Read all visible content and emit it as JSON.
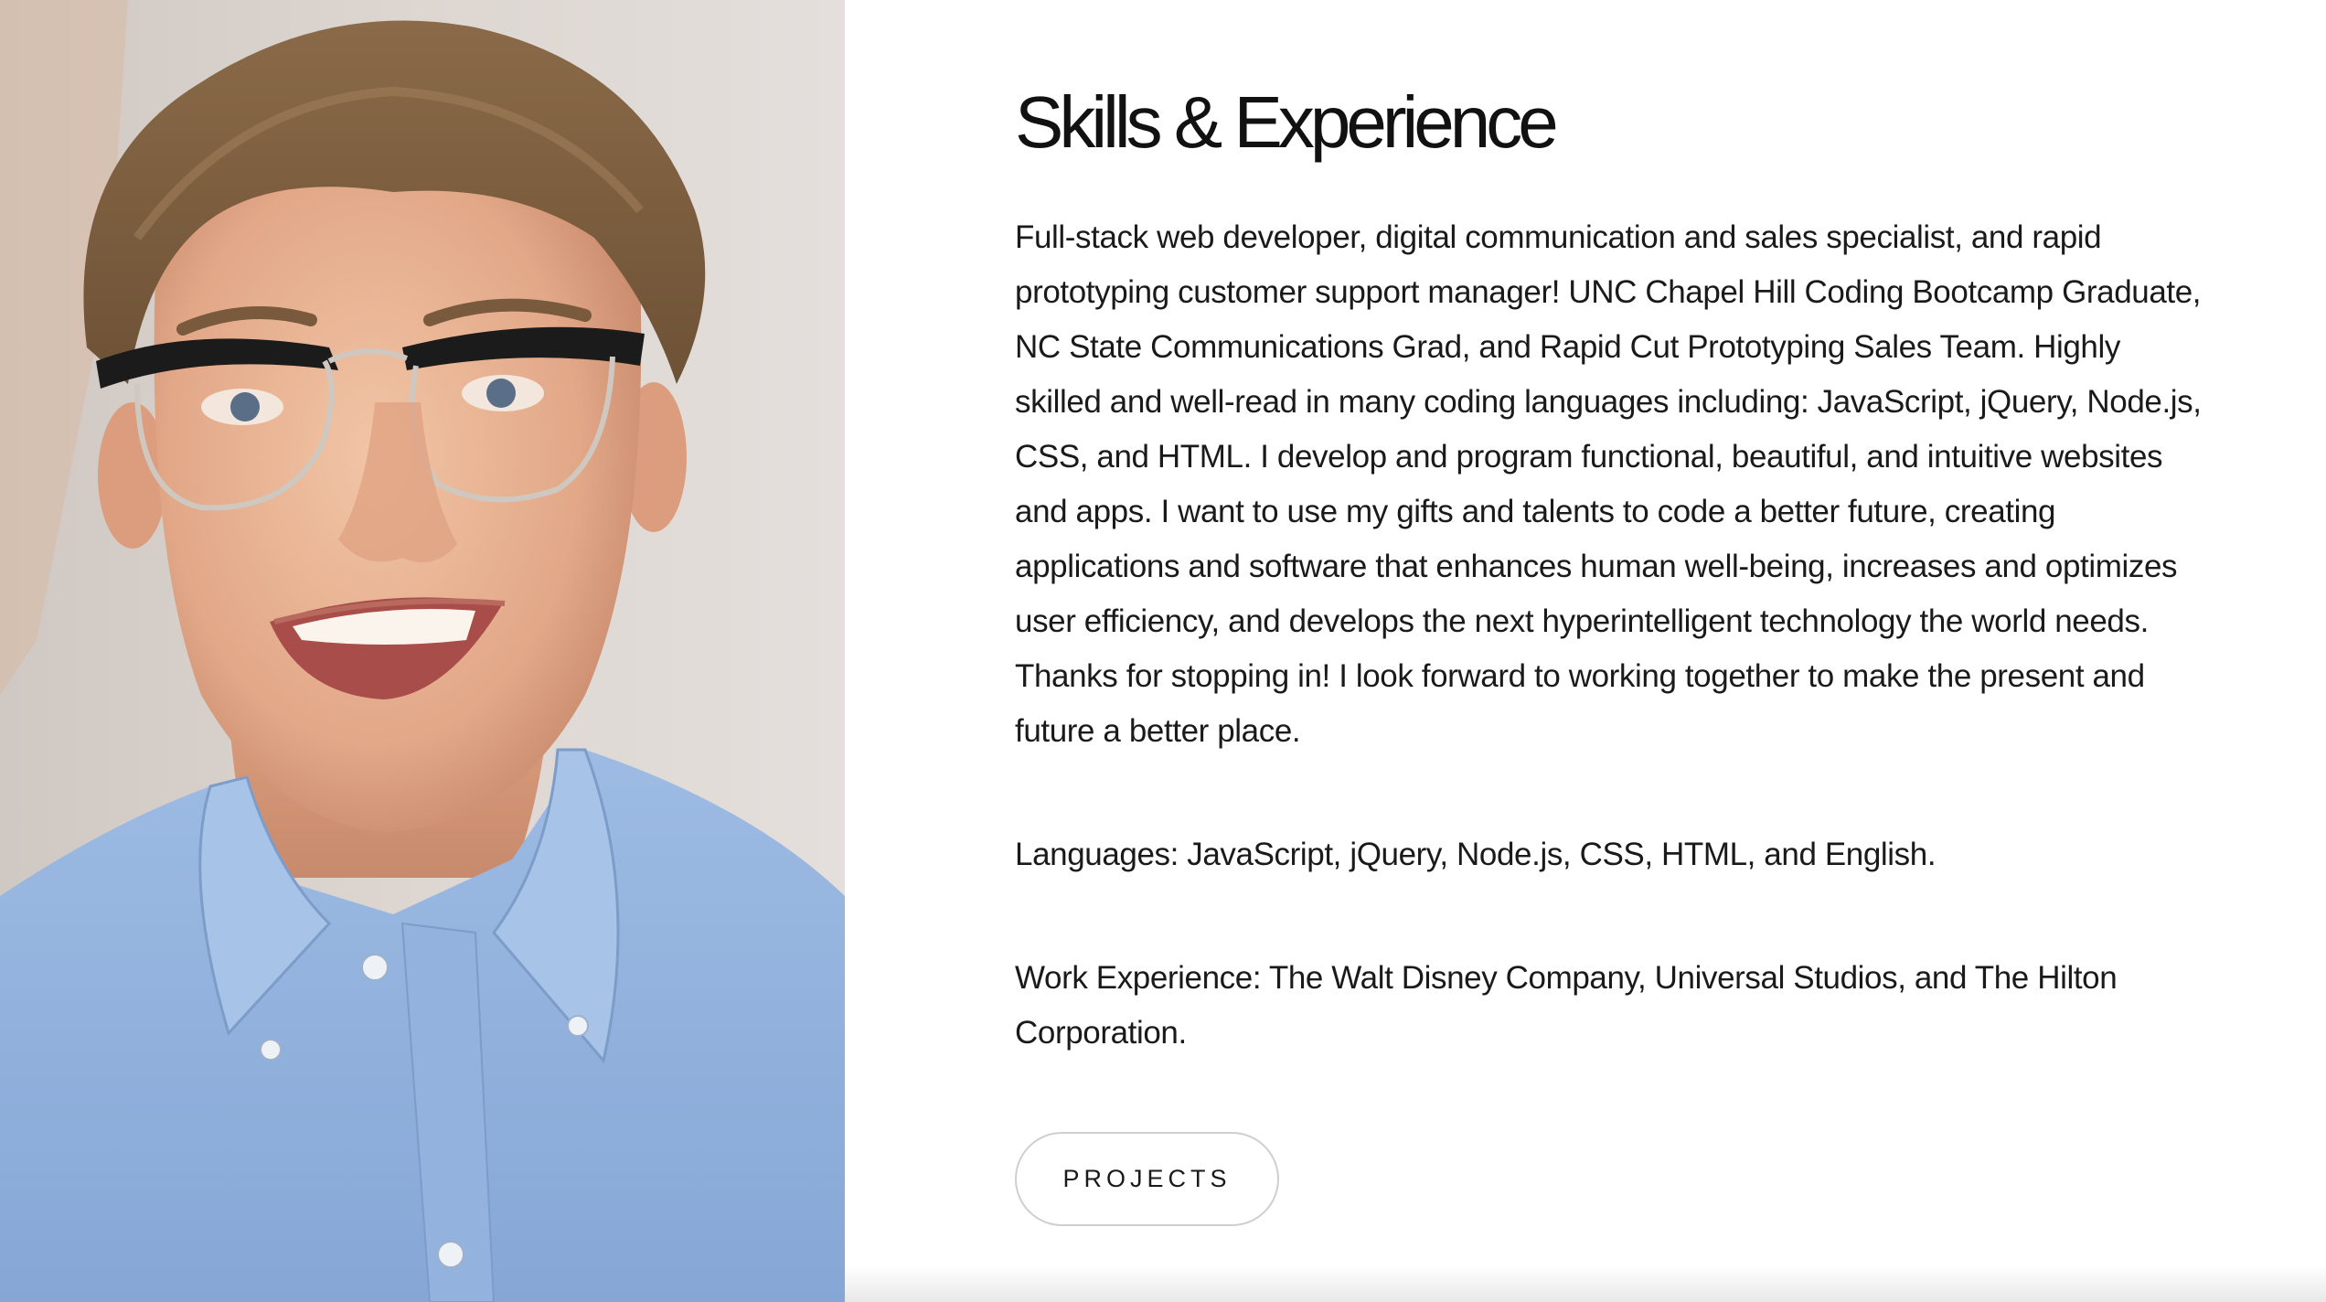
{
  "profile": {
    "photo_alt": "Portrait photo"
  },
  "skills": {
    "title": "Skills & Experience",
    "intro": "Full-stack web developer, digital communication and sales specialist, and rapid prototyping customer support manager! UNC Chapel Hill Coding Bootcamp Graduate, NC State Communications Grad, and Rapid Cut Prototyping Sales Team. Highly skilled and well-read in many coding languages including: JavaScript, jQuery, Node.js, CSS, and HTML. I develop and program functional, beautiful, and intuitive websites and apps. I want to use my gifts and talents to code a better future, creating applications and software that enhances human well-being, increases and optimizes user efficiency, and develops the next hyperintelligent technology the world needs. Thanks for stopping in! I look forward to working together to make the present and future a better place.",
    "languages": "Languages: JavaScript, jQuery, Node.js, CSS, HTML, and English.",
    "work": "Work Experience: The Walt Disney Company, Universal Studios, and The Hilton Corporation.",
    "button_label": "PROJECTS"
  },
  "colors": {
    "background": "#ffffff",
    "text": "#1a1a1a",
    "button_border": "#cfcfcf",
    "shirt": "#8fb0dc"
  }
}
